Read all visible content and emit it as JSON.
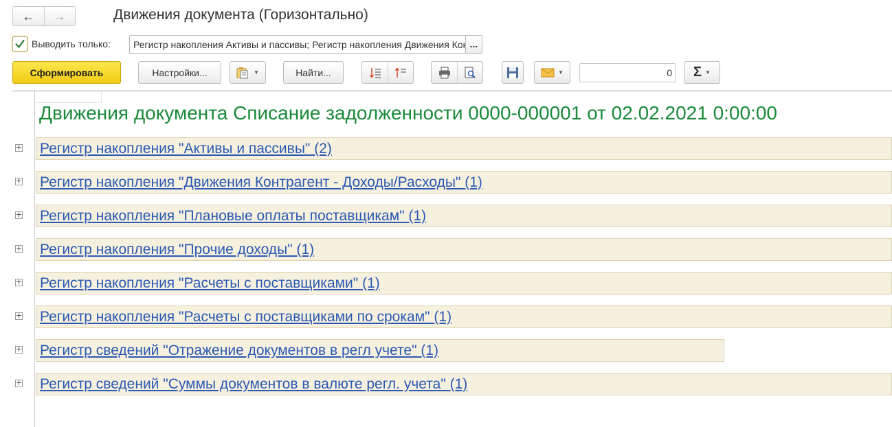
{
  "window": {
    "title": "Движения документа (Горизонтально)",
    "back_icon": "←",
    "forward_icon": "→"
  },
  "filter": {
    "checked": true,
    "label": "Выводить только:",
    "value": "Регистр накопления Активы и пассивы; Регистр накопления Движения Контрагент - Доходы/Расходы; Регистр накопления Плановые оплаты поставщикам",
    "select_button": "..."
  },
  "toolbar": {
    "generate_label": "Сформировать",
    "settings_label": "Настройки...",
    "find_label": "Найти...",
    "number_value": "0"
  },
  "report": {
    "title": "Движения документа Списание задолженности 0000-000001 от 02.02.2021 0:00:00",
    "rows": [
      "Регистр накопления \"Активы и пассивы\" (2)",
      "Регистр накопления \"Движения Контрагент - Доходы/Расходы\" (1)",
      "Регистр накопления \"Плановые оплаты поставщикам\" (1)",
      "Регистр накопления \"Прочие доходы\" (1)",
      "Регистр накопления \"Расчеты с поставщиками\" (1)",
      "Регистр накопления \"Расчеты с поставщиками по срокам\" (1)",
      "Регистр сведений \"Отражение документов в регл учете\" (1)",
      "Регистр сведений \"Суммы документов в валюте регл. учета\" (1)"
    ],
    "expander_symbol": "+"
  },
  "colors": {
    "title_green": "#1a8a3a",
    "link_blue": "#2b58b5",
    "row_bg": "#f6f1de",
    "primary_yellow": "#f2cb14"
  }
}
